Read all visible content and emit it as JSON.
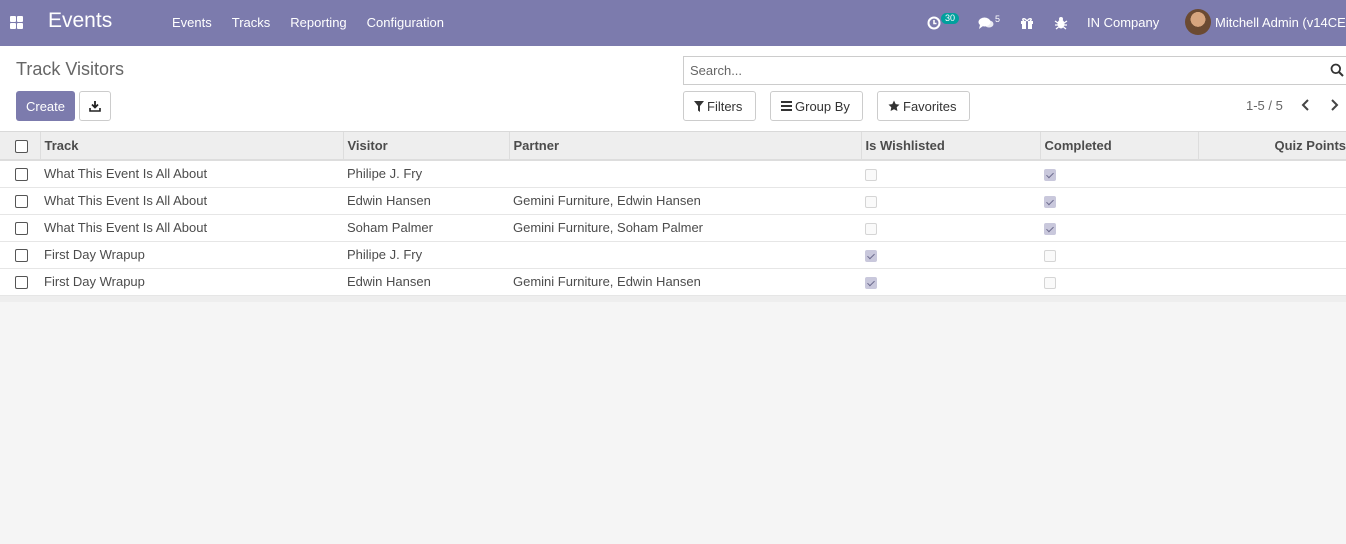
{
  "navbar": {
    "app_title": "Events",
    "menu": [
      "Events",
      "Tracks",
      "Reporting",
      "Configuration"
    ],
    "activity_count": "30",
    "message_count": "5",
    "company": "IN Company",
    "user": "Mitchell Admin (v14CE"
  },
  "control_panel": {
    "title": "Track Visitors",
    "create_label": "Create",
    "search_placeholder": "Search...",
    "filters_label": "Filters",
    "group_by_label": "Group By",
    "favorites_label": "Favorites",
    "pager": "1-5 / 5"
  },
  "table": {
    "columns": [
      "Track",
      "Visitor",
      "Partner",
      "Is Wishlisted",
      "Completed",
      "Quiz Points"
    ],
    "rows": [
      {
        "track": "What This Event Is All About",
        "visitor": "Philipe J. Fry",
        "partner": "",
        "wishlisted": false,
        "completed": true
      },
      {
        "track": "What This Event Is All About",
        "visitor": "Edwin Hansen",
        "partner": "Gemini Furniture, Edwin Hansen",
        "wishlisted": false,
        "completed": true
      },
      {
        "track": "What This Event Is All About",
        "visitor": "Soham Palmer",
        "partner": "Gemini Furniture, Soham Palmer",
        "wishlisted": false,
        "completed": true
      },
      {
        "track": "First Day Wrapup",
        "visitor": "Philipe J. Fry",
        "partner": "",
        "wishlisted": true,
        "completed": false
      },
      {
        "track": "First Day Wrapup",
        "visitor": "Edwin Hansen",
        "partner": "Gemini Furniture, Edwin Hansen",
        "wishlisted": true,
        "completed": false
      }
    ]
  },
  "colors": {
    "brand": "#7c7bad",
    "badge": "#00a09d"
  }
}
